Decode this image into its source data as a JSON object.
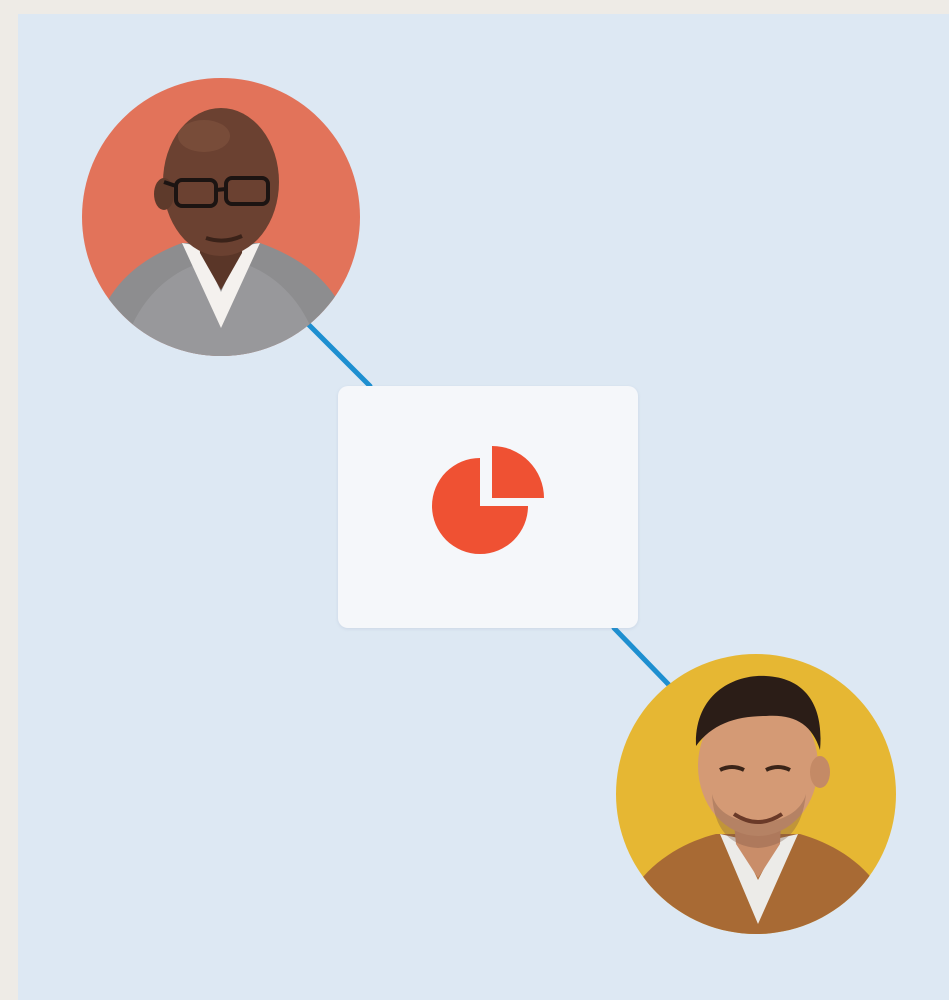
{
  "colors": {
    "background": "#dde8f3",
    "outer": "#eeebe6",
    "connector": "#1e8fd0",
    "card": "#f5f7fa",
    "chart_icon": "#ef5133",
    "avatar_1_bg": "#e2735a",
    "avatar_2_bg": "#e6b733"
  },
  "icons": {
    "card_icon": "pie-chart-icon"
  },
  "people": [
    {
      "avatar": "person-avatar-glasses"
    },
    {
      "avatar": "person-avatar-smiling"
    }
  ]
}
